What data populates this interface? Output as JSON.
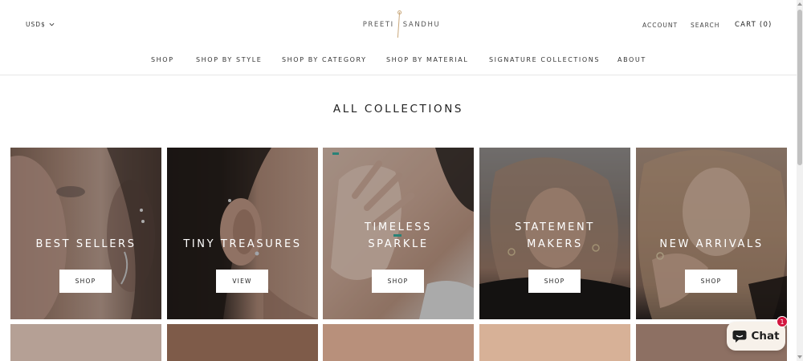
{
  "header": {
    "currency": "USD$",
    "logo_left": "PREETI",
    "logo_right": "SANDHU",
    "account": "ACCOUNT",
    "search": "SEARCH",
    "cart": "CART (0)"
  },
  "nav": {
    "items": [
      "SHOP",
      "SHOP BY STYLE",
      "SHOP BY CATEGORY",
      "SHOP BY MATERIAL",
      "SIGNATURE COLLECTIONS",
      "ABOUT"
    ]
  },
  "page": {
    "title": "ALL COLLECTIONS"
  },
  "collections": [
    {
      "title_lines": [
        "BEST SELLERS"
      ],
      "button": "SHOP",
      "image": "woman-ear-cuff-photo"
    },
    {
      "title_lines": [
        "TINY TREASURES"
      ],
      "button": "VIEW",
      "image": "ear-stud-closeup-photo"
    },
    {
      "title_lines": [
        "TIMELESS",
        "SPARKLE"
      ],
      "button": "SHOP",
      "image": "hand-on-neck-rings-photo"
    },
    {
      "title_lines": [
        "STATEMENT",
        "MAKERS"
      ],
      "button": "SHOP",
      "image": "woman-wavy-hair-photo"
    },
    {
      "title_lines": [
        "NEW ARRIVALS"
      ],
      "button": "SHOP",
      "image": "blonde-woman-rings-photo"
    }
  ],
  "chat": {
    "label": "Chat",
    "badge": "1",
    "icon": "chat-bubble-icon"
  },
  "colors": {
    "accent_gold": "#c9a87c",
    "chat_badge": "#d3153f",
    "swatches": [
      "#b5a095",
      "#7e5b49",
      "#b8907b",
      "#d7b197",
      "#8d7063"
    ]
  }
}
